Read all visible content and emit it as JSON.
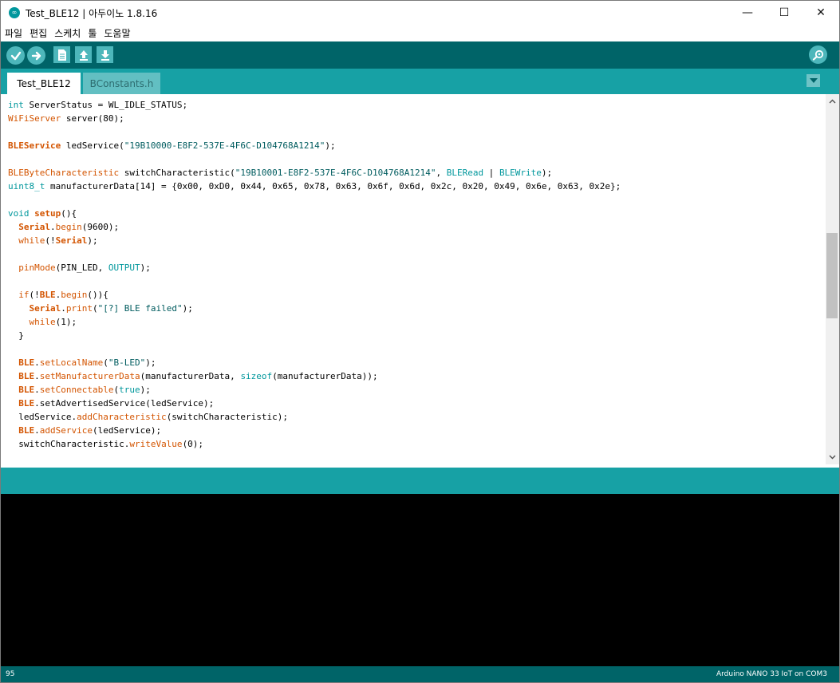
{
  "window": {
    "title": "Test_BLE12 | 아두이노 1.8.16",
    "app_icon_glyph": "∞",
    "minimize": "—",
    "maximize": "☐",
    "close": "✕"
  },
  "menu": {
    "items": [
      "파일",
      "편집",
      "스케치",
      "툴",
      "도움말"
    ]
  },
  "toolbar": {
    "verify_icon": "check-icon",
    "upload_icon": "arrow-right-icon",
    "new_icon": "file-icon",
    "open_icon": "upload-icon",
    "save_icon": "download-icon",
    "serial_monitor_icon": "magnifier-icon"
  },
  "tabs": [
    {
      "label": "Test_BLE12",
      "active": true
    },
    {
      "label": "BConstants.h",
      "active": false
    }
  ],
  "colors": {
    "toolbar": "#006468",
    "tabbar": "#17a1a5",
    "button": "#4db7bb",
    "keyword": "#00979c",
    "function": "#d35400",
    "string": "#005c5f"
  },
  "code": [
    [
      {
        "t": "int",
        "c": "kw"
      },
      {
        "t": " ServerStatus = WL_IDLE_STATUS;"
      }
    ],
    [
      {
        "t": "WiFiServer",
        "c": "ty"
      },
      {
        "t": " server(80);"
      }
    ],
    [],
    [
      {
        "t": "BLEService",
        "c": "cl"
      },
      {
        "t": " ledService("
      },
      {
        "t": "\"19B10000-E8F2-537E-4F6C-D104768A1214\"",
        "c": "st"
      },
      {
        "t": ");"
      }
    ],
    [],
    [
      {
        "t": "BLEByteCharacteristic",
        "c": "ty"
      },
      {
        "t": " switchCharacteristic("
      },
      {
        "t": "\"19B10001-E8F2-537E-4F6C-D104768A1214\"",
        "c": "st"
      },
      {
        "t": ", "
      },
      {
        "t": "BLERead",
        "c": "kw"
      },
      {
        "t": " | "
      },
      {
        "t": "BLEWrite",
        "c": "kw"
      },
      {
        "t": ");"
      }
    ],
    [
      {
        "t": "uint8_t",
        "c": "kw"
      },
      {
        "t": " manufacturerData[14] = {0x00, 0xD0, 0x44, 0x65, 0x78, 0x63, 0x6f, 0x6d, 0x2c, 0x20, 0x49, 0x6e, 0x63, 0x2e};"
      }
    ],
    [],
    [
      {
        "t": "void",
        "c": "kw"
      },
      {
        "t": " "
      },
      {
        "t": "setup",
        "c": "cl"
      },
      {
        "t": "(){"
      }
    ],
    [
      {
        "t": "  "
      },
      {
        "t": "Serial",
        "c": "cl"
      },
      {
        "t": "."
      },
      {
        "t": "begin",
        "c": "fn"
      },
      {
        "t": "(9600);"
      }
    ],
    [
      {
        "t": "  "
      },
      {
        "t": "while",
        "c": "fn"
      },
      {
        "t": "(!"
      },
      {
        "t": "Serial",
        "c": "cl"
      },
      {
        "t": ");"
      }
    ],
    [],
    [
      {
        "t": "  "
      },
      {
        "t": "pinMode",
        "c": "fn"
      },
      {
        "t": "(PIN_LED, "
      },
      {
        "t": "OUTPUT",
        "c": "kw"
      },
      {
        "t": ");"
      }
    ],
    [],
    [
      {
        "t": "  "
      },
      {
        "t": "if",
        "c": "fn"
      },
      {
        "t": "(!"
      },
      {
        "t": "BLE",
        "c": "cl"
      },
      {
        "t": "."
      },
      {
        "t": "begin",
        "c": "fn"
      },
      {
        "t": "()){"
      }
    ],
    [
      {
        "t": "    "
      },
      {
        "t": "Serial",
        "c": "cl"
      },
      {
        "t": "."
      },
      {
        "t": "print",
        "c": "fn"
      },
      {
        "t": "("
      },
      {
        "t": "\"[?] BLE failed\"",
        "c": "st"
      },
      {
        "t": ");"
      }
    ],
    [
      {
        "t": "    "
      },
      {
        "t": "while",
        "c": "fn"
      },
      {
        "t": "(1);"
      }
    ],
    [
      {
        "t": "  }"
      }
    ],
    [],
    [
      {
        "t": "  "
      },
      {
        "t": "BLE",
        "c": "cl"
      },
      {
        "t": "."
      },
      {
        "t": "setLocalName",
        "c": "fn"
      },
      {
        "t": "("
      },
      {
        "t": "\"B-LED\"",
        "c": "st"
      },
      {
        "t": ");"
      }
    ],
    [
      {
        "t": "  "
      },
      {
        "t": "BLE",
        "c": "cl"
      },
      {
        "t": "."
      },
      {
        "t": "setManufacturerData",
        "c": "fn"
      },
      {
        "t": "(manufacturerData, "
      },
      {
        "t": "sizeof",
        "c": "kw"
      },
      {
        "t": "(manufacturerData));"
      }
    ],
    [
      {
        "t": "  "
      },
      {
        "t": "BLE",
        "c": "cl"
      },
      {
        "t": "."
      },
      {
        "t": "setConnectable",
        "c": "fn"
      },
      {
        "t": "("
      },
      {
        "t": "true",
        "c": "kw"
      },
      {
        "t": ");"
      }
    ],
    [
      {
        "t": "  "
      },
      {
        "t": "BLE",
        "c": "cl"
      },
      {
        "t": ".setAdvertisedService(ledService);"
      }
    ],
    [
      {
        "t": "  ledService."
      },
      {
        "t": "addCharacteristic",
        "c": "fn"
      },
      {
        "t": "(switchCharacteristic);"
      }
    ],
    [
      {
        "t": "  "
      },
      {
        "t": "BLE",
        "c": "cl"
      },
      {
        "t": "."
      },
      {
        "t": "addService",
        "c": "fn"
      },
      {
        "t": "(ledService);"
      }
    ],
    [
      {
        "t": "  switchCharacteristic."
      },
      {
        "t": "writeValue",
        "c": "fn"
      },
      {
        "t": "(0);"
      }
    ]
  ],
  "status": {
    "line_number": "95",
    "board": "Arduino NANO 33 IoT on COM3"
  }
}
